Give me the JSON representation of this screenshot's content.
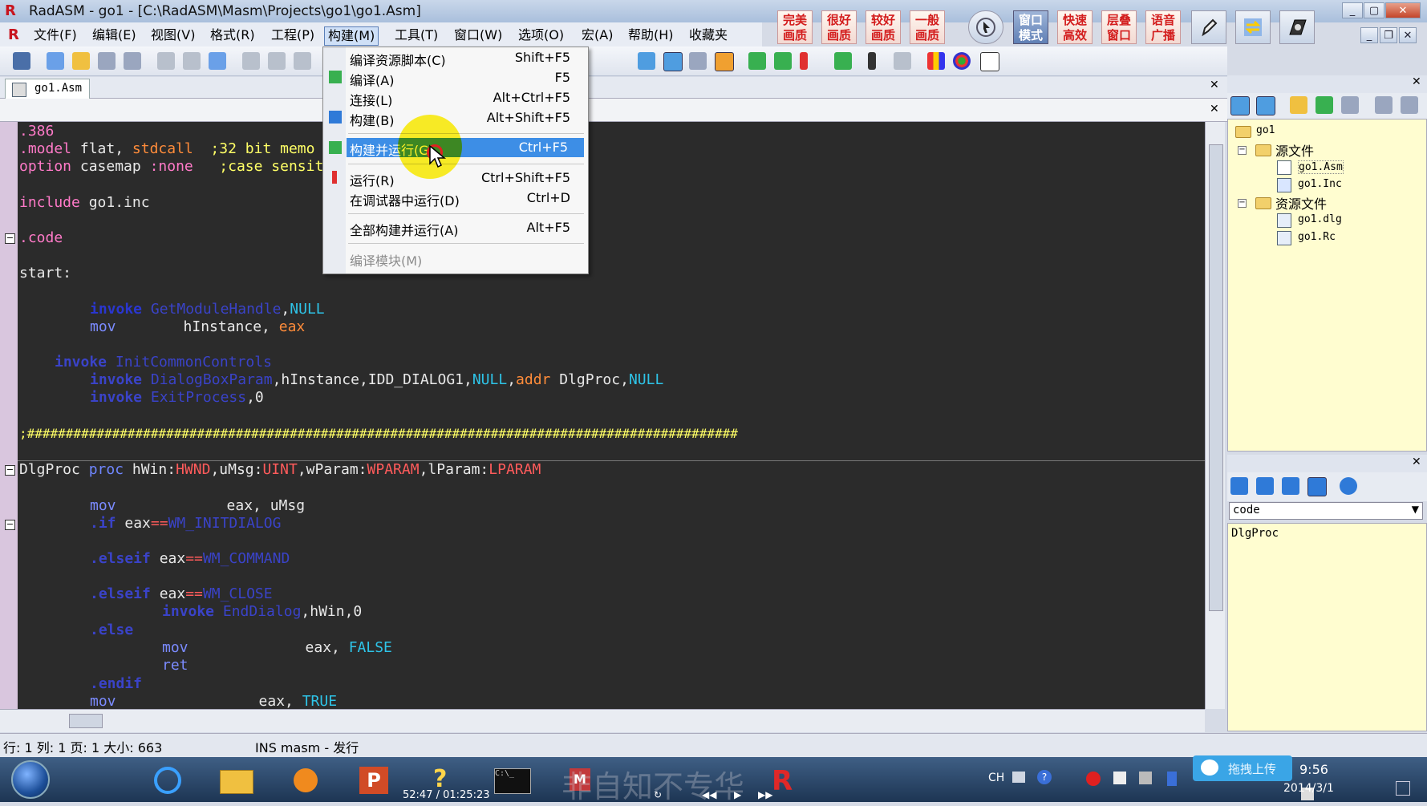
{
  "window": {
    "title": "RadASM - go1 - [C:\\RadASM\\Masm\\Projects\\go1\\go1.Asm]",
    "app_icon": "R"
  },
  "quality_buttons": [
    "完美画质",
    "很好画质",
    "较好画质",
    "一般画质"
  ],
  "mode_buttons": [
    "窗口模式",
    "快速高效",
    "层叠窗口",
    "语音广播"
  ],
  "menubar": {
    "items": [
      "文件(F)",
      "编辑(E)",
      "视图(V)",
      "格式(R)",
      "工程(P)",
      "构建(M)",
      "工具(T)",
      "窗口(W)",
      "选项(O)",
      "宏(A)",
      "帮助(H)",
      "收藏夹"
    ]
  },
  "tab": {
    "label": "go1.Asm"
  },
  "build_menu": {
    "items": [
      {
        "label": "编译资源脚本(C)",
        "shortcut": "Shift+F5"
      },
      {
        "label": "编译(A)",
        "shortcut": "F5"
      },
      {
        "label": "连接(L)",
        "shortcut": "Alt+Ctrl+F5"
      },
      {
        "label": "构建(B)",
        "shortcut": "Alt+Shift+F5"
      },
      {
        "label": "构建并运行(G)",
        "shortcut": "Ctrl+F5"
      },
      {
        "label": "运行(R)",
        "shortcut": "Ctrl+Shift+F5"
      },
      {
        "label": "在调试器中运行(D)",
        "shortcut": "Ctrl+D"
      },
      {
        "label": "全部构建并运行(A)",
        "shortcut": "Alt+F5"
      },
      {
        "label": "编译模块(M)",
        "shortcut": ""
      }
    ],
    "highlighted_index": 4,
    "disabled_index": 8
  },
  "code": {
    "l1": ".386",
    "l2a": ".model",
    "l2b": " flat, ",
    "l2c": "stdcall",
    "l2d": "  ;32 bit memo",
    "l3a": "option",
    "l3b": " casemap ",
    "l3c": ":none",
    "l3d": "   ;case sensit",
    "l4a": "include",
    "l4b": " go1.inc",
    "l5": ".code",
    "l6": "start:",
    "l7a": "invoke",
    "l7b": " GetModuleHandle",
    "l7c": ",",
    "l7d": "NULL",
    "l8a": "mov",
    "l8b": "hInstance,",
    "l8c": " eax",
    "l9a": "invoke",
    "l9b": " InitCommonControls",
    "l10a": "invoke",
    "l10b": " DialogBoxParam",
    "l10c": ",hInstance,IDD_DIALOG1,",
    "l10d": "NULL",
    "l10e": ",",
    "l10f": "addr",
    "l10g": " DlgProc,",
    "l10h": "NULL",
    "l11a": "invoke",
    "l11b": " ExitProcess",
    "l11c": ",0",
    "l12": ";############################################################################################",
    "l13a": "DlgProc",
    "l13b": " proc",
    "l13c": " hWin:",
    "l13d": "HWND",
    "l13e": ",uMsg:",
    "l13f": "UINT",
    "l13g": ",wParam:",
    "l13h": "WPARAM",
    "l13i": ",lParam:",
    "l13j": "LPARAM",
    "l14a": "mov",
    "l14b": "eax,",
    "l14c": " uMsg",
    "l15a": ".if",
    "l15b": " eax",
    "l15c": "==",
    "l15d": "WM_INITDIALOG",
    "l16a": ".elseif",
    "l16b": " eax",
    "l16c": "==",
    "l16d": "WM_COMMAND",
    "l17a": ".elseif",
    "l17b": " eax",
    "l17c": "==",
    "l17d": "WM_CLOSE",
    "l18a": "invoke",
    "l18b": " EndDialog",
    "l18c": ",hWin,0",
    "l19": ".else",
    "l20a": "mov",
    "l20b": "eax,",
    "l20c": " FALSE",
    "l21": "ret",
    "l22": ".endif",
    "l23a": "mov",
    "l23b": "eax,",
    "l23c": " TRUE"
  },
  "statusbar": {
    "position": "行: 1   列: 1 页: 1 大小: 663",
    "mode": "INS masm - 发行"
  },
  "project": {
    "root": "go1",
    "folder_source": "源文件",
    "file_asm": "go1.Asm",
    "file_inc": "go1.Inc",
    "folder_resource": "资源文件",
    "file_dlg": "go1.dlg",
    "file_rc": "go1.Rc"
  },
  "properties": {
    "select_value": "code",
    "list_item": "DlgProc"
  },
  "taskbar": {
    "player_time": "52:47 / 01:25:23",
    "ime": "CH",
    "clock_time": "9:56",
    "clock_date": "2014/3/1",
    "upload_label": "拖拽上传",
    "watermark": "非自知不专华"
  },
  "colors": {
    "editor_bg": "#2b2b2b",
    "menu_highlight": "#3d8ee6",
    "cursor_halo": "#fff000"
  }
}
